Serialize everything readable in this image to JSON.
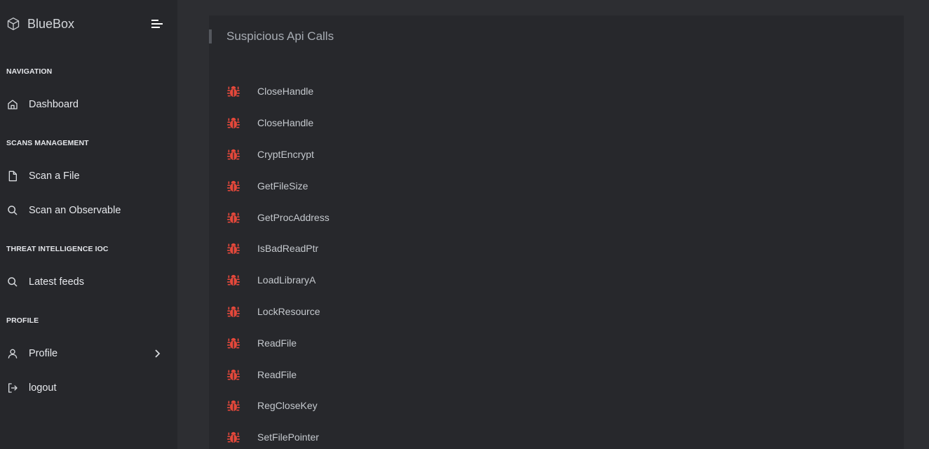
{
  "brand": {
    "name": "BlueBox",
    "icon": "cube-icon"
  },
  "sidebar": {
    "toggle_icon": "menu-toggle-icon",
    "sections": [
      {
        "heading": "NAVIGATION",
        "items": [
          {
            "label": "Dashboard",
            "icon": "home-icon"
          }
        ]
      },
      {
        "heading": "SCANS MANAGEMENT",
        "items": [
          {
            "label": "Scan a File",
            "icon": "file-icon"
          },
          {
            "label": "Scan an Observable",
            "icon": "search-icon"
          }
        ]
      },
      {
        "heading": "THREAT INTELLIGENCE IOC",
        "items": [
          {
            "label": "Latest feeds",
            "icon": "search-icon"
          }
        ]
      },
      {
        "heading": "PROFILE",
        "items": [
          {
            "label": "Profile",
            "icon": "user-icon",
            "chevron": "chevron-right-icon"
          },
          {
            "label": "logout",
            "icon": "logout-icon"
          }
        ]
      }
    ]
  },
  "main": {
    "card": {
      "title": "Suspicious Api Calls",
      "item_icon": "bug-icon",
      "item_icon_color": "#e5483b",
      "api_calls": [
        "CloseHandle",
        "CloseHandle",
        "CryptEncrypt",
        "GetFileSize",
        "GetProcAddress",
        "IsBadReadPtr",
        "LoadLibraryA",
        "LockResource",
        "ReadFile",
        "ReadFile",
        "RegCloseKey",
        "SetFilePointer"
      ]
    }
  },
  "colors": {
    "sidebar_bg": "#26272b",
    "page_bg": "#2d2e32",
    "card_bg": "#27282c",
    "text_primary": "#e6e8ec",
    "text_muted": "#a7acb3",
    "bug_red": "#e5483b"
  }
}
